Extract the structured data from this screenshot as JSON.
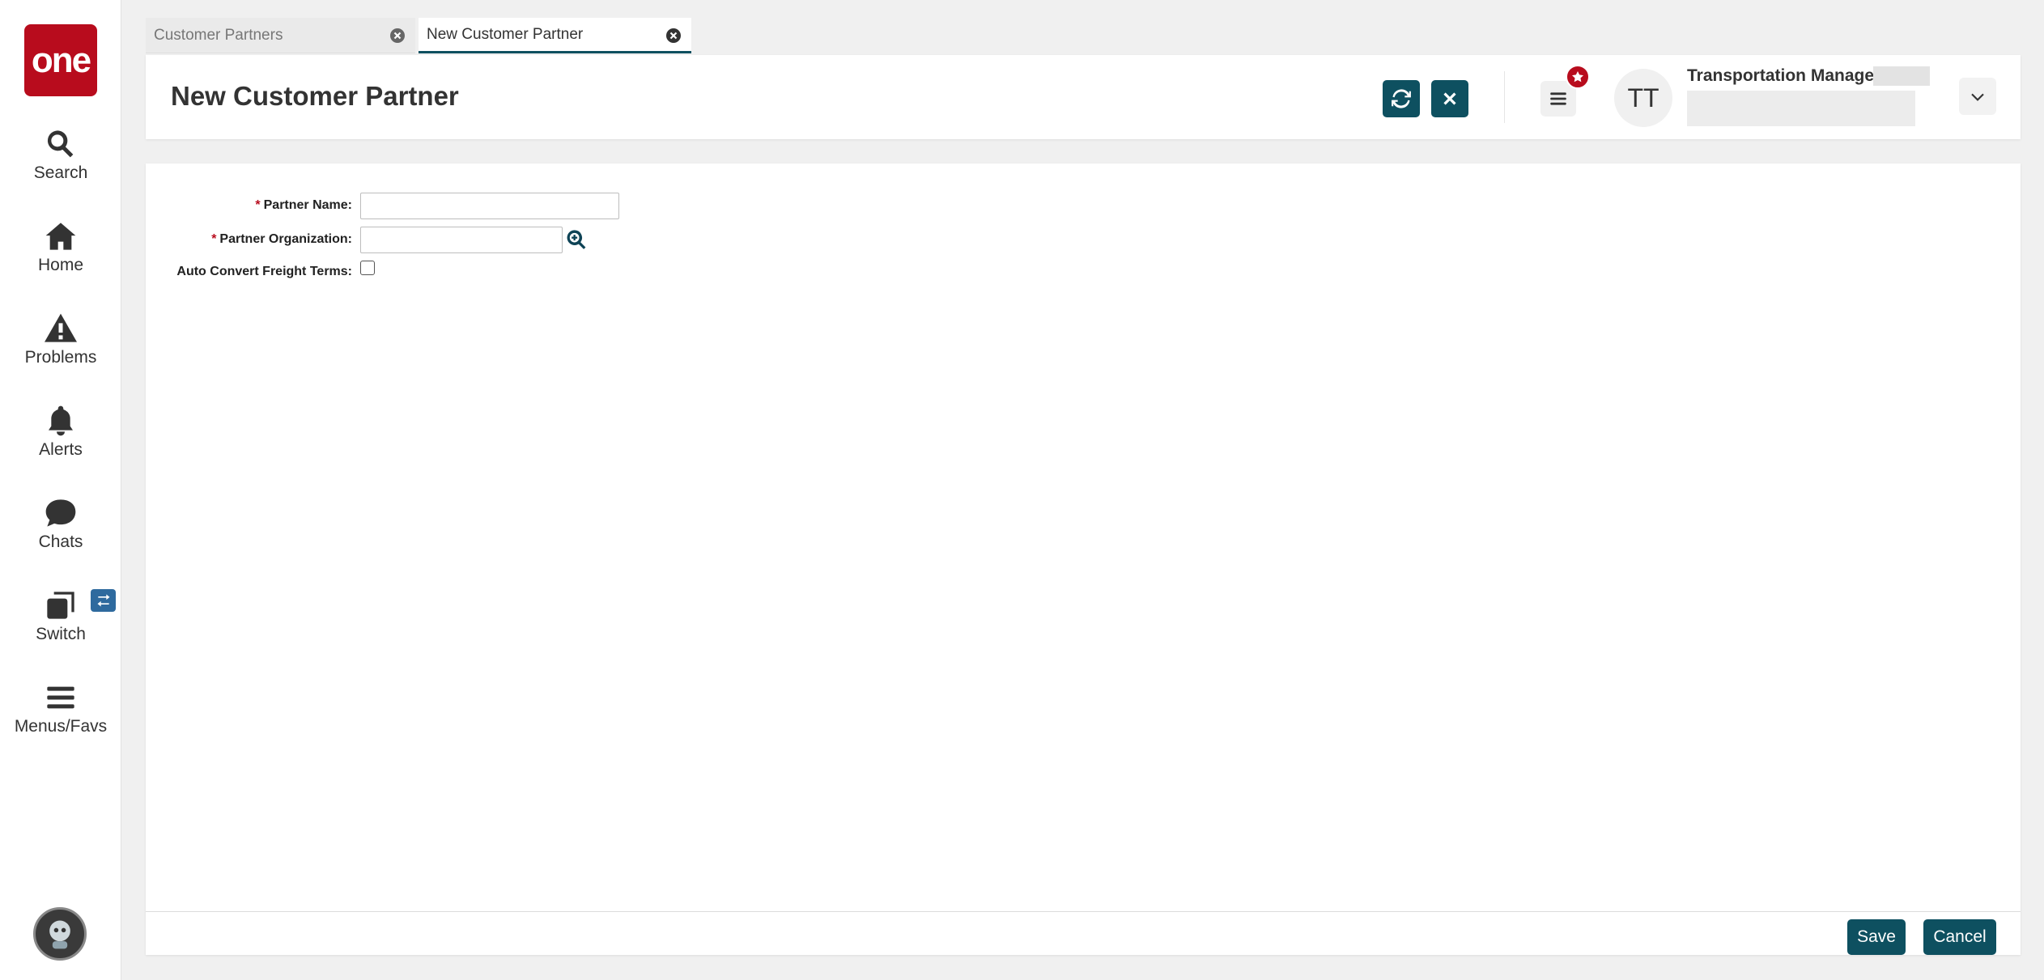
{
  "sidebar": {
    "logo_text": "one",
    "items": [
      {
        "label": "Search",
        "icon": "search-icon"
      },
      {
        "label": "Home",
        "icon": "home-icon"
      },
      {
        "label": "Problems",
        "icon": "warning-icon"
      },
      {
        "label": "Alerts",
        "icon": "bell-icon"
      },
      {
        "label": "Chats",
        "icon": "chat-icon"
      },
      {
        "label": "Switch",
        "icon": "switch-icon"
      },
      {
        "label": "Menus/Favs",
        "icon": "hamburger-icon"
      }
    ]
  },
  "tabs": [
    {
      "label": "Customer Partners",
      "active": false
    },
    {
      "label": "New Customer Partner",
      "active": true
    }
  ],
  "header": {
    "title": "New Customer Partner",
    "user_initials": "TT",
    "user_role": "Transportation Manager"
  },
  "form": {
    "partner_name_label": "Partner Name:",
    "partner_org_label": "Partner Organization:",
    "auto_convert_label": "Auto Convert Freight Terms:",
    "required_marker": "*",
    "partner_name_value": "",
    "partner_org_value": "",
    "auto_convert_checked": false
  },
  "footer": {
    "save_label": "Save",
    "cancel_label": "Cancel"
  },
  "colors": {
    "brand_red": "#b80c1d",
    "primary_teal": "#0e5060"
  }
}
